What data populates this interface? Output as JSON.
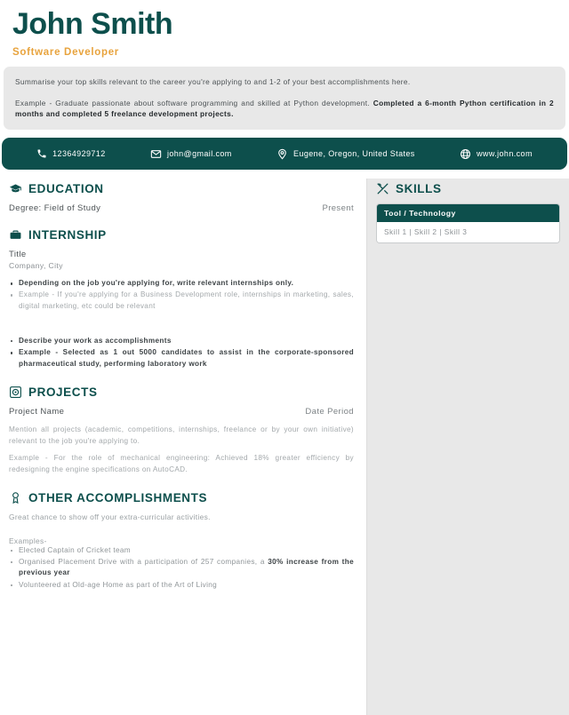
{
  "header": {
    "name": "John Smith",
    "job_title": "Software Developer",
    "name_color": "#0d4f4c",
    "title_color": "#e8a33d"
  },
  "summary": {
    "line1": "Summarise your top skills relevant to the career you're applying to and 1-2 of your best accomplishments here.",
    "line2_normal": "Example - Graduate passionate about software programming and skilled at Python development. ",
    "line2_bold": "Completed a 6-month Python certification in 2 months and completed 5 freelance development projects."
  },
  "contact": [
    {
      "icon": "phone-icon",
      "text": "12364929712"
    },
    {
      "icon": "email-icon",
      "text": "john@gmail.com"
    },
    {
      "icon": "location-pin-icon",
      "text": "Eugene, Oregon, United States"
    },
    {
      "icon": "globe-icon",
      "text": "www.john.com"
    }
  ],
  "education": {
    "heading": "EDUCATION",
    "icon": "graduation-cap-icon",
    "degree": "Degree: Field of Study",
    "date": "Present"
  },
  "internship": {
    "heading": "INTERNSHIP",
    "icon": "briefcase-icon",
    "title": "Title",
    "company": "Company, City",
    "bullets_group1": [
      "Depending on the job you're applying for, write relevant internships only.",
      "Example - If you're applying for a Business Development role, internships in marketing, sales, digital marketing, etc could be relevant"
    ],
    "bullets_group2": [
      "Describe your work as accomplishments",
      "Example - Selected as 1 out 5000 candidates to assist in the corporate-sponsored pharmaceutical study, performing laboratory work"
    ]
  },
  "projects": {
    "heading": "PROJECTS",
    "icon": "project-aperture-icon",
    "name": "Project Name",
    "date": "Date Period",
    "para1": "Mention all projects (academic, competitions, internships, freelance or by your own initiative) relevant to the job you're applying to.",
    "para2": "Example - For the role of mechanical engineering: Achieved 18% greater efficiency by redesigning the engine specifications on AutoCAD."
  },
  "accomplishments": {
    "heading": "OTHER ACCOMPLISHMENTS",
    "icon": "award-ribbon-icon",
    "intro": "Great chance to show off your extra-curricular activities.",
    "examples_label": "Examples-",
    "item1": "Elected Captain of Cricket team",
    "item2_a": "Organised Placement Drive with a participation of 257 companies, a ",
    "item2_b": "30% increase from the previous year",
    "item3": "Volunteered at Old-age Home as part of the Art of Living"
  },
  "skills": {
    "heading": "SKILLS",
    "icon": "tools-icon",
    "table_header": "Tool / Technology",
    "table_row": "Skill 1  |  Skill 2  |  Skill 3"
  },
  "theme": {
    "primary": "#0d4f4c",
    "accent": "#e8a33d",
    "panel_bg": "#e8e8e8"
  }
}
